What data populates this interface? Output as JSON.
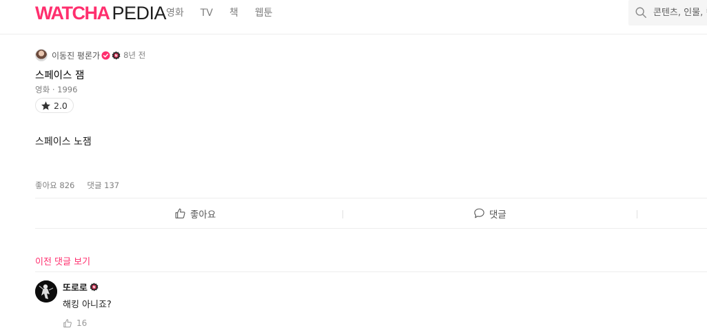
{
  "header": {
    "logo_main": "WATCHA",
    "logo_sub": "PEDIA",
    "nav": [
      "영화",
      "TV",
      "책",
      "웹툰"
    ],
    "search_placeholder": "콘텐츠, 인물, 컬렉션, 유저를 검색해보세요."
  },
  "review": {
    "author": "이동진 평론가",
    "time_ago": "8년 전",
    "content_title": "스페이스 잼",
    "content_meta": "영화 · 1996",
    "rating": "2.0",
    "text": "스페이스 노잼",
    "likes_label": "좋아요 826",
    "comments_label": "댓글 137"
  },
  "actions": {
    "like_label": "좋아요",
    "comment_label": "댓글"
  },
  "comments": {
    "prev_label": "이전 댓글 보기",
    "items": [
      {
        "user": "또로로",
        "text": "해킹 아니죠?",
        "likes": "16"
      }
    ]
  },
  "colors": {
    "brand": "#ff2f6e",
    "verified": "#ff2f6e",
    "badge_dark": "#2b2b2b"
  }
}
